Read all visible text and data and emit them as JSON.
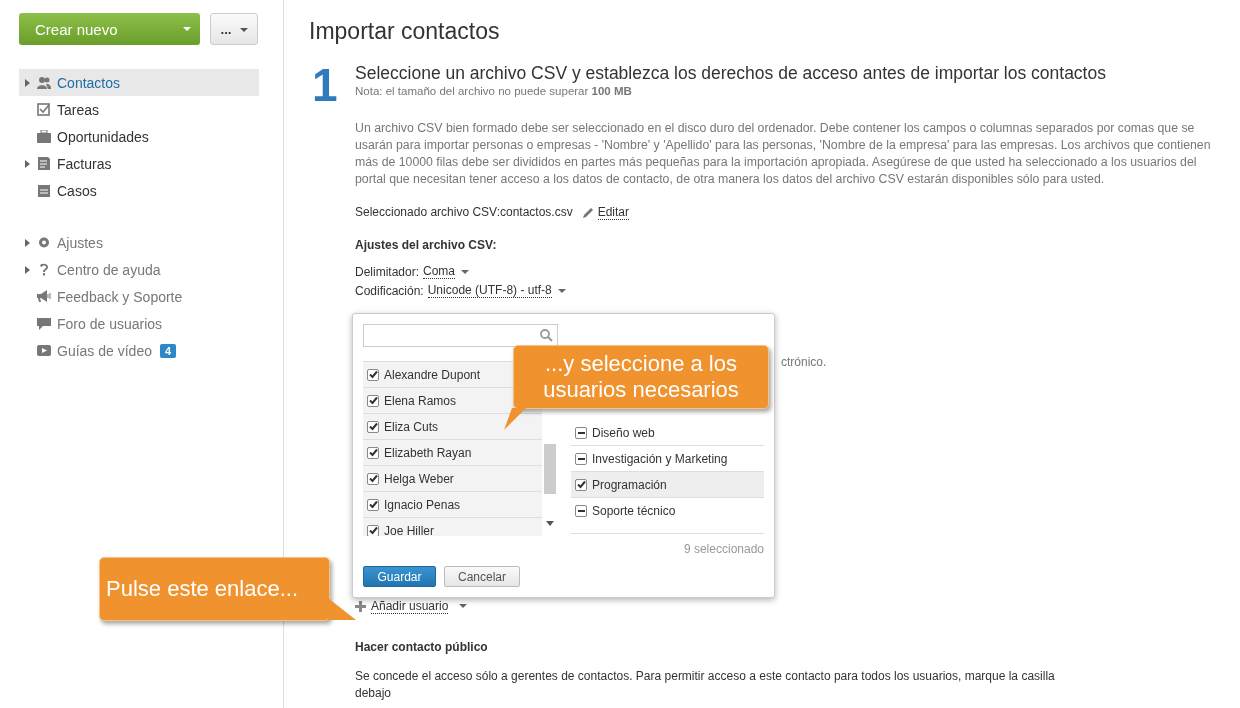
{
  "sidebar": {
    "create_button": "Crear nuevo",
    "more_button": "...",
    "main_items": [
      {
        "label": "Contactos",
        "selected": true,
        "expandable": true
      },
      {
        "label": "Tareas",
        "selected": false,
        "expandable": false
      },
      {
        "label": "Oportunidades",
        "selected": false,
        "expandable": false
      },
      {
        "label": "Facturas",
        "selected": false,
        "expandable": true
      },
      {
        "label": "Casos",
        "selected": false,
        "expandable": false
      }
    ],
    "extra_items": [
      {
        "label": "Ajustes",
        "expandable": true
      },
      {
        "label": "Centro de ayuda",
        "expandable": true
      },
      {
        "label": "Feedback y Soporte",
        "expandable": false
      },
      {
        "label": "Foro de usuarios",
        "expandable": false
      },
      {
        "label": "Guías de vídeo",
        "expandable": false,
        "badge": "4"
      }
    ]
  },
  "page_title": "Importar contactos",
  "step": {
    "number": "1",
    "heading": "Seleccione un archivo CSV y establezca los derechos de acceso antes de importar los contactos",
    "note": "Nota: el tamaño del archivo no puede superar **100 MB**"
  },
  "description": "Un archivo CSV bien formado debe ser seleccionado en el disco duro del ordenador. Debe contener los campos o columnas separados por comas que se usarán para importar personas o empresas - 'Nombre' y 'Apellido' para las personas, 'Nombre de la empresa' para las empresas. Los archivos que contienen más de 10000 filas debe ser divididos en partes más pequeñas para la importación apropiada. Asegúrese de que usted ha seleccionado a los usuarios del portal que necesitan tener acceso a los datos de contacto, de otra manera los datos del archivo CSV estarán disponibles sólo para usted.",
  "selected_file": {
    "label": "Seleccionado archivo CSV:",
    "file": "contactos.csv",
    "edit_link": "Editar"
  },
  "csv_settings": {
    "heading": "Ajustes del archivo CSV:",
    "rows": [
      {
        "label": "Delimitador:",
        "value": "Coma"
      },
      {
        "label": "Codificación:",
        "value": "Unicode (UTF-8) - utf-8"
      }
    ]
  },
  "covered_text_tail": "ctrónico.",
  "user_picker": {
    "users": [
      {
        "name": "Alexandre Dupont",
        "checked": true
      },
      {
        "name": "Elena Ramos",
        "checked": true
      },
      {
        "name": "Eliza Cuts",
        "checked": true
      },
      {
        "name": "Elizabeth Rayan",
        "checked": true
      },
      {
        "name": "Helga Weber",
        "checked": true
      },
      {
        "name": "Ignacio Penas",
        "checked": true
      },
      {
        "name": "Joe Hiller",
        "checked": true
      }
    ],
    "groups": [
      {
        "name": "Diseño web",
        "checked": false,
        "indeterminate": true
      },
      {
        "name": "Investigación y Marketing",
        "checked": false,
        "indeterminate": true
      },
      {
        "name": "Programación",
        "checked": true,
        "indeterminate": false
      },
      {
        "name": "Soporte técnico",
        "checked": false,
        "indeterminate": true
      }
    ],
    "count": "9 seleccionado",
    "save_button": "Guardar",
    "cancel_button": "Cancelar"
  },
  "add_user_link": "Añadir usuario",
  "public_section": {
    "heading": "Hacer contacto público",
    "text": "Se concede el acceso sólo a gerentes de contactos. Para permitir acceso a este contacto para todos los usuarios, marque la casilla debajo"
  },
  "callouts": [
    {
      "kind": "down-left",
      "text": "...y seleccione a los usuarios necesarios"
    },
    {
      "kind": "right",
      "text": "Pulse este enlace..."
    }
  ]
}
